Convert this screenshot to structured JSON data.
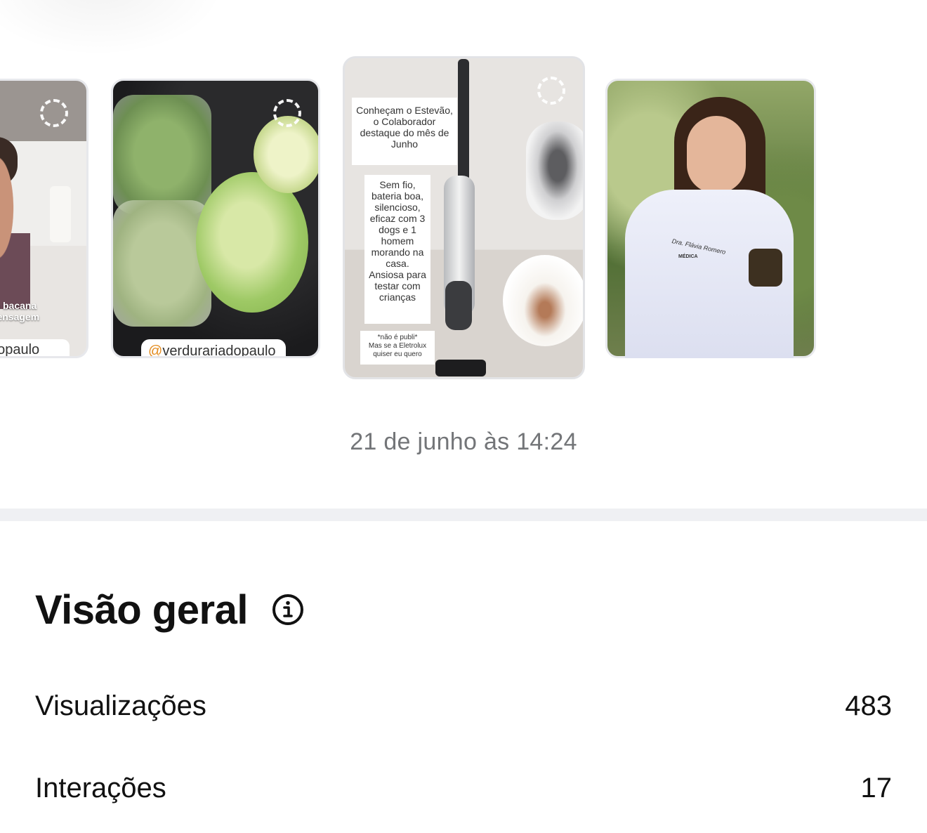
{
  "stories": [
    {
      "caption_lines": [
        "ito bacana",
        "mensagem"
      ],
      "tag": "dopaulo"
    },
    {
      "tag_at": "@",
      "tag": "verdurariadopaulo"
    },
    {
      "text_top": "Conheçam o Estevão, o Colaborador destaque do mês de Junho",
      "text_middle": "Sem fio, bateria boa, silencioso, eficaz com 3 dogs e 1 homem morando na casa. Ansiosa para testar com crianças",
      "text_bottom_1": "*não é publi*",
      "text_bottom_2": "Mas se a Eletrolux quiser eu quero"
    },
    {
      "coat_text": "Dra. Flávia Romero",
      "coat_subtext": "MÉDICA"
    }
  ],
  "timestamp": "21 de junho às 14:24",
  "overview": {
    "title": "Visão geral",
    "info_icon": "info-icon",
    "rows": [
      {
        "label": "Visualizações",
        "value": "483"
      },
      {
        "label": "Interações",
        "value": "17"
      }
    ]
  }
}
